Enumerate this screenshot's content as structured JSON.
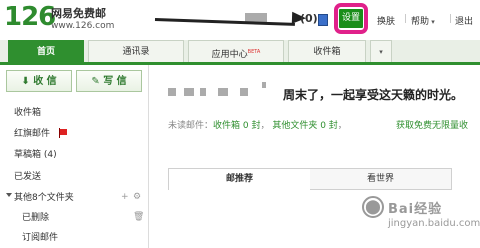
{
  "header": {
    "logo_number": "126",
    "logo_name": "网易免费邮",
    "logo_url": "www.126.com",
    "mail_count": "(0)",
    "settings_label": "设置",
    "skin_label": "换肤",
    "help_label": "帮助",
    "logout_label": "退出"
  },
  "tabs": [
    {
      "label": "首页"
    },
    {
      "label": "通讯录"
    },
    {
      "label": "应用中心",
      "badge": "BETA"
    },
    {
      "label": "收件箱"
    }
  ],
  "sidebar": {
    "receive_label": "收 信",
    "write_label": "写 信",
    "items": [
      {
        "label": "收件箱"
      },
      {
        "label": "红旗邮件"
      },
      {
        "label": "草稿箱 (4)"
      },
      {
        "label": "已发送"
      },
      {
        "label": "其他8个文件夹"
      },
      {
        "label": "已删除"
      },
      {
        "label": "订阅邮件"
      }
    ]
  },
  "main": {
    "greeting": "周末了，一起享受这天籁的时光。",
    "unread_label": "未读邮件：",
    "inbox_unread": "收件箱 0 封",
    "other_unread": "其他文件夹 0 封",
    "promo": "获取免费无限量收",
    "content_tabs": [
      {
        "label": "邮推荐"
      },
      {
        "label": "看世界"
      }
    ]
  },
  "watermark": {
    "text": "Bai经验",
    "url": "jingyan.baidu.com"
  },
  "colors": {
    "brand_green": "#2f8f2f",
    "highlight": "#e0218a",
    "flag_red": "#d22"
  }
}
